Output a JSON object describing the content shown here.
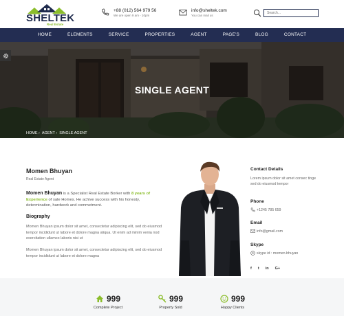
{
  "brand": {
    "name": "SHELTEK",
    "tagline": "Real Estate"
  },
  "header": {
    "phone": {
      "main": "+88 (012) 564 979 56",
      "sub": "We are open 9 am - 10pm"
    },
    "email": {
      "main": "info@sheltek.com",
      "sub": "You can mail us"
    },
    "search_placeholder": "Search..."
  },
  "nav": [
    "HOME",
    "ELEMENTS",
    "SERVICE",
    "PROPERTIES",
    "AGENT",
    "PAGE'S",
    "BLOG",
    "CONTACT"
  ],
  "hero": {
    "title": "SINGLE AGENT",
    "breadcrumb": [
      "HOME",
      "›",
      "AGENT",
      "›",
      "SINGLE AGENT"
    ]
  },
  "agent": {
    "name": "Momen Bhuyan",
    "role": "Real Estate Agent",
    "intro_name": "Momen Bhuyan",
    "intro_pre": " is a Specialist Real Estate Borker with ",
    "intro_highlight": "8 years of Experience",
    "intro_post": " of sale Homes. He achive success with his honesty, determination, hardwork and commetment.",
    "bio_title": "Biography",
    "bio_p1": "Momen Bhuyan ipsum dolor sit amet, consectetur adipiscing elit, sed do eiusmod tempor incididunt ut labore et dolore magna aliqua. Ut enim ad minim venia nod exercitation ullamco laboris nisi ut",
    "bio_p2": "Momen Bhuyan ipsum dolor sit amet, consectetur adipiscing elit, sed do eiusmod tempor incididunt ut labore et dolore magna"
  },
  "contact": {
    "title": "Contact Details",
    "text": "Lorem ipsum dolor sit amet consec tinge sed do eiusmod tempor",
    "phone_label": "Phone",
    "phone_value": "+1245 785 659",
    "email_label": "Email",
    "email_value": "info@gmail.com",
    "skype_label": "Skype",
    "skype_value": "skype id : momen.bhuyan",
    "socials": [
      "f",
      "t",
      "in",
      "G+"
    ]
  },
  "stats": [
    {
      "value": "999",
      "label": "Complete Project",
      "icon": "home-icon"
    },
    {
      "value": "999",
      "label": "Property Sold",
      "icon": "key-icon"
    },
    {
      "value": "999",
      "label": "Happy Clients",
      "icon": "smile-icon"
    }
  ],
  "colors": {
    "navy": "#232d52",
    "accent": "#8bbd2b"
  }
}
